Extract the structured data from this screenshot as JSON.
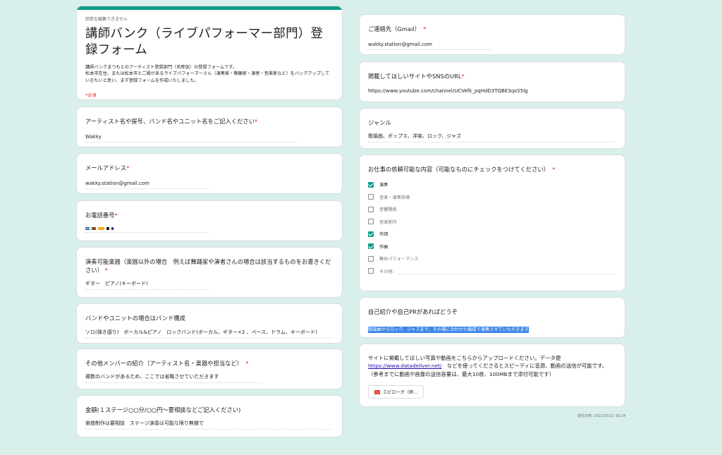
{
  "header": {
    "cant_edit": "回答を編集できません",
    "title": "講師バンク（ライブパフォーマー部門）登録フォーム",
    "desc_line1": "講師バンクまつもとのアーティスト登録部門（名称仮）の登録フォームです。",
    "desc_line2": "松本市在住、または松本市とご縁があるライブパフォーマーさん（演奏家・舞踊家・演者・音楽家など）をバックアップしていきたいと思い、まず登録フォームを作成いたしました。",
    "required_note": "*必須"
  },
  "left": {
    "artist": {
      "q": "アーティスト名や屋号、バンド名やユニット名をご記入ください",
      "req": "*",
      "a": "Wakky"
    },
    "email": {
      "q": "メールアドレス",
      "req": "*",
      "a": "wakky.station@gmail.com"
    },
    "phone": {
      "q": "お電話番号",
      "req": "*"
    },
    "instrument": {
      "q": "演奏可能楽器（楽器以外の場合　例えば舞踊家や演者さんの場合は該当するものをお書きください）",
      "req": "*",
      "a": "ギター　ピアノ(キーボード)"
    },
    "band": {
      "q": "バンドやユニットの場合はバンド構成",
      "a": "ソロ(弾き語り)　ボーカル&ピアノ　ロックバンド(ボーカル、ギター×2 、ベース、ドラム、キーボード)"
    },
    "members": {
      "q": "その他メンバーの紹介（アーティスト名・楽器や担当など）",
      "req": "*",
      "a": "複数のバンドがあるため、ここでは省略させていただきます"
    },
    "fee": {
      "q": "金額(１ステージ○○分/○○円〜要相談などご記入ください)",
      "a": "楽曲制作は要相談　ステージ演奏は可能な限り無償で"
    }
  },
  "right": {
    "contact": {
      "q": "ご連絡先（Gmail）",
      "req": "*",
      "a": "wakky.station@gmail.com"
    },
    "url": {
      "q": "掲載してほしいサイトやSNSのURL",
      "req": "*",
      "a": "https://www.youtube.com/channel/UCVefk_pqHdD3TQBE3qxS5lg"
    },
    "genre": {
      "q": "ジャンル",
      "a": "歌謡曲、ポップス、洋楽、ロック、ジャズ"
    },
    "work": {
      "q": "お仕事の依頼可能な内容（可能なものにチェックをつけてください）",
      "req": "*",
      "options": [
        {
          "label": "演奏"
        },
        {
          "label": "音楽・演奏指導"
        },
        {
          "label": "音響関係"
        },
        {
          "label": "音楽制作"
        },
        {
          "label": "作詞"
        },
        {
          "label": "作曲"
        },
        {
          "label": "舞台パフォーマンス"
        },
        {
          "label": "その他:"
        }
      ]
    },
    "pr": {
      "q": "自己紹介や自己PRがあればどうぞ",
      "a": "歌謡曲からロック、ジャズまで、その場に合わせた編成で演奏させていただきます"
    },
    "upload": {
      "q1": "サイトに掲載してほしい写真や動画をこちらからアップロードください。データ便",
      "link": "https://www.datadeliver.net/",
      "q2": "　などを使ってくださるとスピーディに音源、動画の送信が可能です。",
      "q3": "（参考までに動画や画像の送信容量は、最大10枚、100MBまで添付可能です）",
      "file": "エピローグ（絆..."
    },
    "submit_date": "送信日時: 2021/03/22 16:24"
  },
  "colors": {
    "accent": "#0c9d8a",
    "background": "#d9efec",
    "required": "#d93025"
  },
  "icons": {
    "checkbox": "checkbox-icon",
    "file": "file-icon",
    "flag": "flag-icon"
  }
}
